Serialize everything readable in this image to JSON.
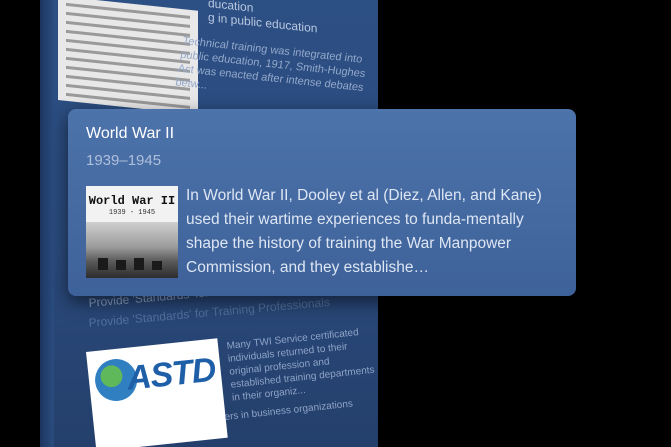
{
  "background_card": {
    "top_title": "ducation",
    "top_title_line2": "g in public education",
    "top_text": "Technical training was integrated into public education, 1917, Smith-Hughes Act was enacted after intense debates betw...",
    "section_heading": "Provide 'Standards' for Training Professionals",
    "section_heading_ghost": "Provide 'Standards' for Training Professionals",
    "section_text": "Many TWI Service certificated individuals returned to their original profession and established training departments in their organiz...",
    "footer_text": "ers in business organizations",
    "logo_word": "ASTD"
  },
  "popup": {
    "title": "World War II",
    "years": "1939–1945",
    "thumbnail_title": "World War II",
    "thumbnail_years": "1939 - 1945",
    "description": "In World War II, Dooley et al (Diez, Allen, and Kane) used their wartime experiences to funda-mentally shape the history of training the War Manpower Commission, and they establishe…"
  },
  "colors": {
    "background": "#000000",
    "card": "#2c4f84",
    "popup": "#4d73ab"
  }
}
